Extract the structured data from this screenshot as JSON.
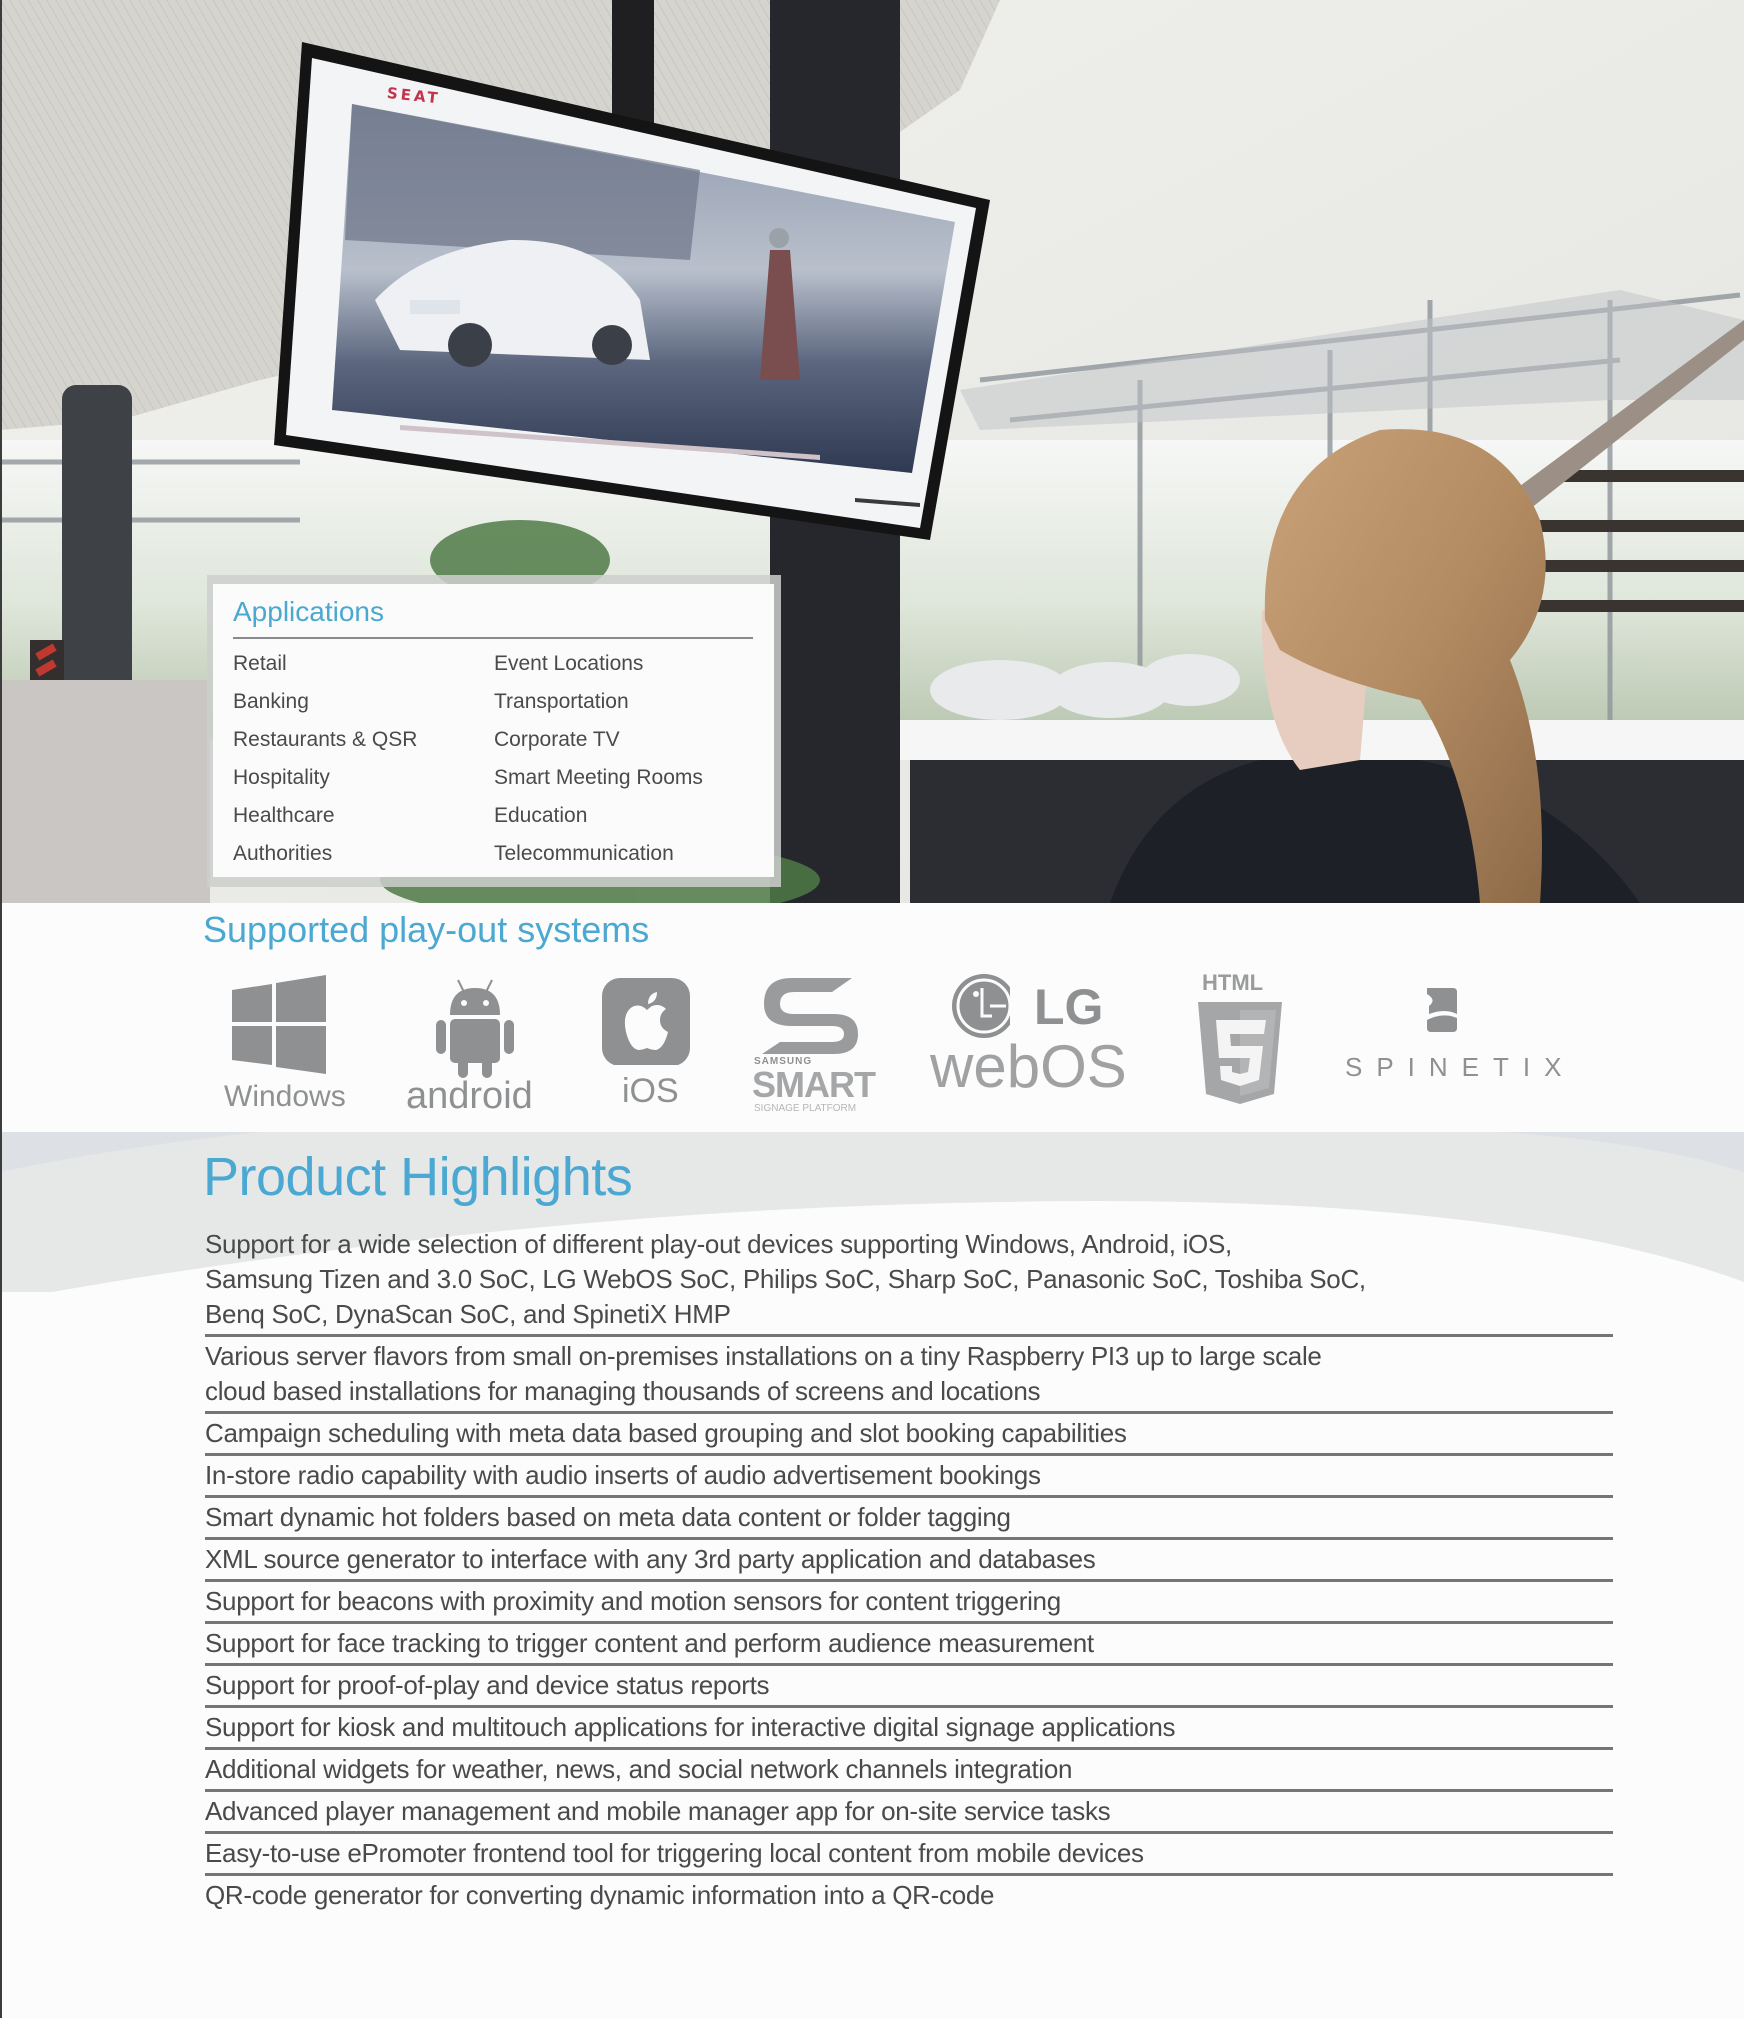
{
  "photo": {
    "description": "Woman at a desk in a car showroom looking at a wall-mounted digital signage screen",
    "screen_brand": "SEAT"
  },
  "applications": {
    "title": "Applications",
    "column1": [
      "Retail",
      "Banking",
      "Restaurants & QSR",
      "Hospitality",
      "Healthcare",
      "Authorities"
    ],
    "column2": [
      "Event Locations",
      "Transportation",
      "Corporate TV",
      "Smart Meeting Rooms",
      "Education",
      "Telecommunication"
    ]
  },
  "supported": {
    "title": "Supported play-out systems",
    "logos": [
      {
        "name": "windows",
        "icon": "windows-logo-icon",
        "label": "Windows"
      },
      {
        "name": "android",
        "icon": "android-logo-icon",
        "label": "android"
      },
      {
        "name": "ios",
        "icon": "apple-logo-icon",
        "label": "iOS"
      },
      {
        "name": "samsung",
        "icon": "samsung-smart-signage-logo-icon",
        "label_top": "SAMSUNG",
        "label": "SMART",
        "label_bottom": "SIGNAGE PLATFORM"
      },
      {
        "name": "lg-webos",
        "icon": "lg-logo-icon",
        "label_top": "LG",
        "label": "webOS"
      },
      {
        "name": "html5",
        "icon": "html5-shield-icon",
        "label_top": "HTML",
        "label": "5"
      },
      {
        "name": "spinetix",
        "icon": "spinetix-logo-icon",
        "label": "SPINETIX"
      }
    ]
  },
  "highlights": {
    "title": "Product Highlights",
    "items": [
      [
        "Support for a wide selection of different play-out devices supporting Windows, Android, iOS,",
        "Samsung Tizen and 3.0 SoC, LG WebOS SoC, Philips SoC, Sharp SoC, Panasonic SoC, Toshiba SoC,",
        "Benq SoC, DynaScan SoC, and SpinetiX HMP"
      ],
      [
        "Various server flavors from small on-premises installations on a tiny Raspberry PI3 up to large scale",
        "cloud based installations for managing thousands of screens and locations"
      ],
      [
        "Campaign scheduling with meta data based grouping and slot booking capabilities"
      ],
      [
        "In-store radio capability with audio inserts of audio advertisement bookings"
      ],
      [
        "Smart dynamic hot folders based on meta data content or folder tagging"
      ],
      [
        "XML source generator to interface with any 3rd party application and databases"
      ],
      [
        "Support for beacons with proximity and motion sensors for content triggering"
      ],
      [
        "Support for face tracking to trigger content and perform audience measurement"
      ],
      [
        "Support for proof-of-play and device status reports"
      ],
      [
        "Support for kiosk and multitouch applications for interactive digital signage applications"
      ],
      [
        "Additional widgets for weather, news, and social network channels integration"
      ],
      [
        "Advanced player management and mobile manager app for on-site service tasks"
      ],
      [
        "Easy-to-use ePromoter frontend tool for triggering local content from mobile devices"
      ],
      [
        "QR-code generator for converting dynamic information into a QR-code"
      ]
    ]
  },
  "colors": {
    "accent_blue": "#4aa8d2",
    "body_text": "#4a4a4c",
    "logo_gray": "#8e9091",
    "band_gray": "#e6e8e7",
    "rule_gray": "#757575"
  }
}
